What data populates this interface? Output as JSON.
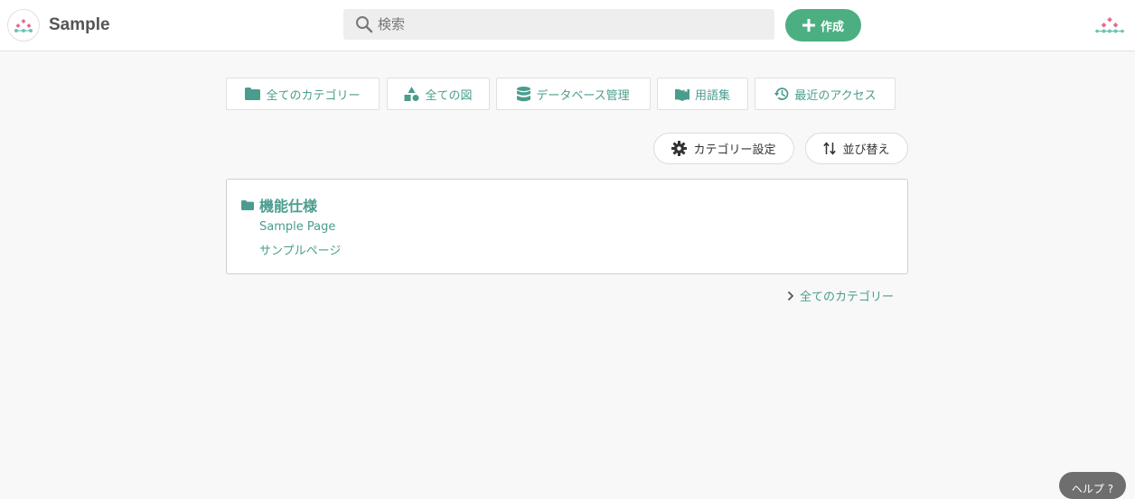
{
  "header": {
    "title": "Sample",
    "search_placeholder": "検索",
    "create_label": "作成"
  },
  "nav": {
    "all_categories": "全てのカテゴリー",
    "all_diagrams": "全ての図",
    "database_management": "データベース管理",
    "glossary": "用語集",
    "recent_access": "最近のアクセス"
  },
  "actions": {
    "category_settings": "カテゴリー設定",
    "sort": "並び替え"
  },
  "category_card": {
    "title": "機能仕様",
    "pages": [
      "Sample Page",
      "サンプルページ"
    ]
  },
  "footer_link": "全てのカテゴリー",
  "help_label": "ヘルプ ?",
  "colors": {
    "accent": "#4a9d8d",
    "create_button": "#4caf82",
    "logo_pink": "#e86a92",
    "logo_teal": "#6cc4b4"
  }
}
